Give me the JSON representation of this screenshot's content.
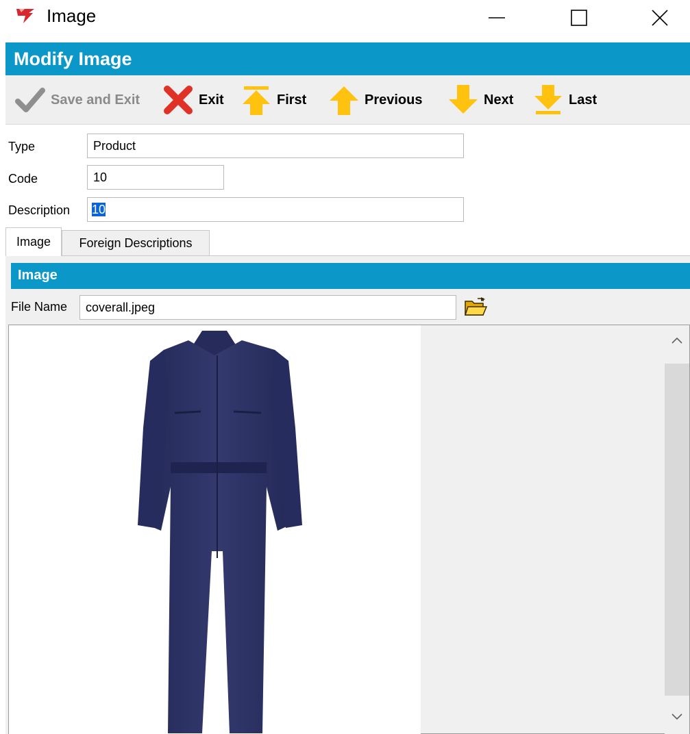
{
  "window": {
    "title": "Image",
    "icon": "app-logo-icon",
    "controls": [
      "minimize-icon",
      "maximize-icon",
      "close-icon"
    ]
  },
  "header": {
    "title": "Modify Image"
  },
  "toolbar": {
    "save_exit": {
      "label": "Save and Exit",
      "icon": "checkmark-icon",
      "enabled": false
    },
    "exit": {
      "label": "Exit",
      "icon": "red-x-icon"
    },
    "first": {
      "label": "First",
      "icon": "arrow-up-bar-icon"
    },
    "previous": {
      "label": "Previous",
      "icon": "arrow-up-icon"
    },
    "next": {
      "label": "Next",
      "icon": "arrow-down-icon"
    },
    "last": {
      "label": "Last",
      "icon": "arrow-down-bar-icon"
    }
  },
  "form": {
    "type": {
      "label": "Type",
      "value": "Product"
    },
    "code": {
      "label": "Code",
      "value": "10"
    },
    "description": {
      "label": "Description",
      "value": "10"
    }
  },
  "tabs": [
    {
      "label": "Image",
      "active": true
    },
    {
      "label": "Foreign Descriptions",
      "active": false
    }
  ],
  "image_section": {
    "title": "Image",
    "file_name_label": "File Name",
    "file_name_value": "coverall.jpeg",
    "browse_icon": "open-folder-icon",
    "preview_icon": "coverall-image"
  },
  "colors": {
    "header_blue": "#0b98c9",
    "toolbar_gray": "#efefef",
    "arrow_yellow": "#ffc20e",
    "exit_red": "#e03126",
    "coverall_navy": "#2a2f5e"
  }
}
